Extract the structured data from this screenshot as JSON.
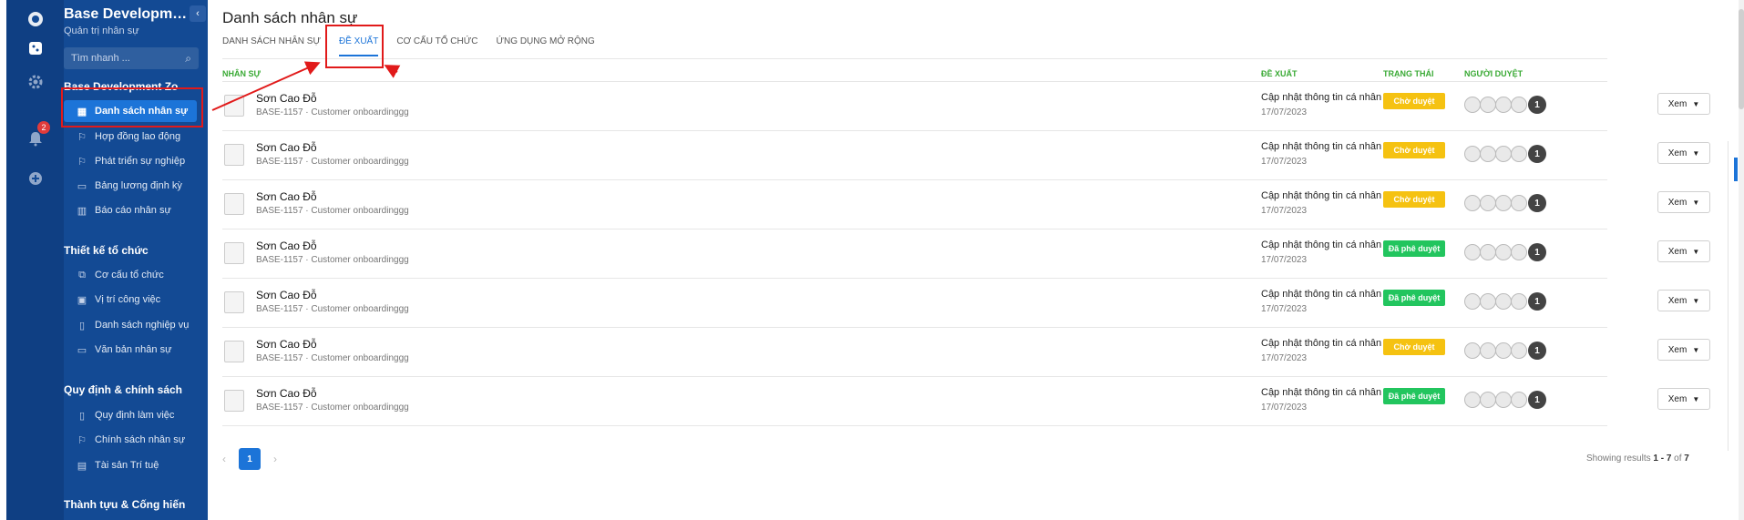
{
  "app": {
    "title": "Base Development ...",
    "subtitle": "Quản trị nhân sự"
  },
  "rail": {
    "notifications_count": "2"
  },
  "search": {
    "placeholder": "Tìm nhanh ..."
  },
  "nav": {
    "group_title": "Base Development Zo",
    "items_top": [
      {
        "label": "Danh sách nhân sự",
        "icon": "grid-icon",
        "active": true
      },
      {
        "label": "Hợp đồng lao động",
        "icon": "flag-icon"
      },
      {
        "label": "Phát triển sự nghiệp",
        "icon": "flag-icon"
      },
      {
        "label": "Bảng lương định kỳ",
        "icon": "folder-icon"
      },
      {
        "label": "Báo cáo nhân sự",
        "icon": "chart-icon"
      }
    ],
    "section_design": "Thiết kế tổ chức",
    "items_design": [
      {
        "label": "Cơ cấu tổ chức",
        "icon": "org-icon"
      },
      {
        "label": "Vị trí công việc",
        "icon": "briefcase-icon"
      },
      {
        "label": "Danh sách nghiệp vụ",
        "icon": "book-icon"
      },
      {
        "label": "Văn bản nhân sự",
        "icon": "folder-icon"
      }
    ],
    "section_policy": "Quy định & chính sách",
    "items_policy": [
      {
        "label": "Quy định làm việc",
        "icon": "book-icon"
      },
      {
        "label": "Chính sách nhân sự",
        "icon": "flag-icon"
      },
      {
        "label": "Tài sản Trí tuệ",
        "icon": "doc-icon"
      }
    ],
    "section_achievement": "Thành tựu & Cống hiến"
  },
  "page": {
    "title": "Danh sách nhân sự",
    "tabs": [
      "DANH SÁCH NHÂN SỰ",
      "ĐỀ XUẤT",
      "CƠ CẤU TỔ CHỨC",
      "ỨNG DỤNG MỞ RỘNG"
    ],
    "active_tab": 1
  },
  "table": {
    "headers": {
      "employee": "NHÂN SỰ",
      "request": "ĐỀ XUẤT",
      "status": "TRẠNG THÁI",
      "approvers": "NGƯỜI DUYỆT"
    },
    "rows": [
      {
        "name": "Sơn Cao Đỗ",
        "meta": "BASE-1157 · Customer onboardinggg",
        "request": "Cập nhật thông tin cá nhân",
        "date": "17/07/2023",
        "status": "Chờ duyệt",
        "status_type": "pending",
        "approver_count": "1",
        "action": "Xem"
      },
      {
        "name": "Sơn Cao Đỗ",
        "meta": "BASE-1157 · Customer onboardinggg",
        "request": "Cập nhật thông tin cá nhân",
        "date": "17/07/2023",
        "status": "Chờ duyệt",
        "status_type": "pending",
        "approver_count": "1",
        "action": "Xem"
      },
      {
        "name": "Sơn Cao Đỗ",
        "meta": "BASE-1157 · Customer onboardinggg",
        "request": "Cập nhật thông tin cá nhân",
        "date": "17/07/2023",
        "status": "Chờ duyệt",
        "status_type": "pending",
        "approver_count": "1",
        "action": "Xem"
      },
      {
        "name": "Sơn Cao Đỗ",
        "meta": "BASE-1157 · Customer onboardinggg",
        "request": "Cập nhật thông tin cá nhân",
        "date": "17/07/2023",
        "status": "Đã phê duyệt",
        "status_type": "approved",
        "approver_count": "1",
        "action": "Xem"
      },
      {
        "name": "Sơn Cao Đỗ",
        "meta": "BASE-1157 · Customer onboardinggg",
        "request": "Cập nhật thông tin cá nhân",
        "date": "17/07/2023",
        "status": "Đã phê duyệt",
        "status_type": "approved",
        "approver_count": "1",
        "action": "Xem"
      },
      {
        "name": "Sơn Cao Đỗ",
        "meta": "BASE-1157 · Customer onboardinggg",
        "request": "Cập nhật thông tin cá nhân",
        "date": "17/07/2023",
        "status": "Chờ duyệt",
        "status_type": "pending",
        "approver_count": "1",
        "action": "Xem"
      },
      {
        "name": "Sơn Cao Đỗ",
        "meta": "BASE-1157 · Customer onboardinggg",
        "request": "Cập nhật thông tin cá nhân",
        "date": "17/07/2023",
        "status": "Đã phê duyệt",
        "status_type": "approved",
        "approver_count": "1",
        "action": "Xem"
      }
    ]
  },
  "pagination": {
    "current": "1",
    "results_prefix": "Showing results ",
    "range": "1 - 7",
    "of": " of ",
    "total": "7"
  },
  "colors": {
    "sidebar": "#134a94",
    "accent": "#1c74d8",
    "pending": "#f5c211",
    "approved": "#22c55e",
    "annotation": "#e11a1a"
  }
}
